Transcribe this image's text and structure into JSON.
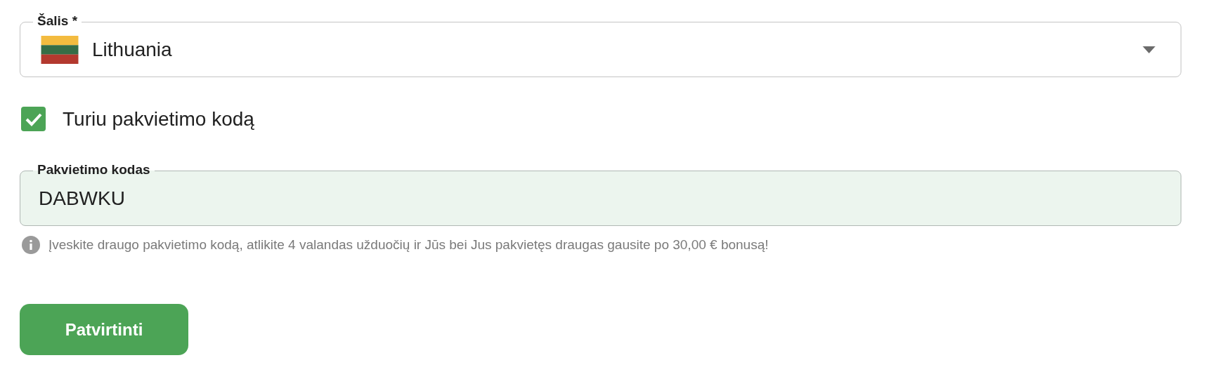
{
  "country_select": {
    "label": "Šalis *",
    "value": "Lithuania"
  },
  "invite_checkbox": {
    "label": "Turiu pakvietimo kodą",
    "checked": true
  },
  "invite_code": {
    "label": "Pakvietimo kodas",
    "value": "DABWKU"
  },
  "helper_text": "Įveskite draugo pakvietimo kodą, atlikite 4 valandas užduočių ir Jūs bei Jus pakvietęs draugas gausite po 30,00 € bonusą!",
  "submit_button": {
    "label": "Patvirtinti"
  }
}
